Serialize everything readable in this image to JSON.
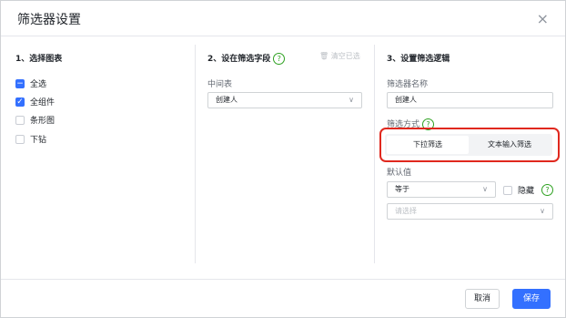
{
  "dialog": {
    "title": "筛选器设置",
    "close_glyph": "×"
  },
  "col1": {
    "title": "1、选择图表",
    "items": [
      {
        "label": "全选",
        "state": "indeterminate",
        "mark": "−"
      },
      {
        "label": "全组件",
        "state": "checked",
        "mark": "✓"
      },
      {
        "label": "条形图",
        "state": "unchecked",
        "mark": ""
      },
      {
        "label": "下钻",
        "state": "unchecked",
        "mark": ""
      }
    ]
  },
  "col2": {
    "title": "2、设在筛选字段",
    "help": "?",
    "clear_label": "🗑 清空已选",
    "table_label": "中间表",
    "field_value": "创建人",
    "chevron": "∨"
  },
  "col3": {
    "title": "3、设置筛选逻辑",
    "name_label": "筛选器名称",
    "name_value": "创建人",
    "mode_label": "筛选方式",
    "help": "?",
    "tabs": [
      {
        "label": "下拉筛选",
        "active": true
      },
      {
        "label": "文本输入筛选",
        "active": false
      }
    ],
    "default_label": "默认值",
    "operator_value": "等于",
    "hide_label": "隐藏",
    "value_placeholder": "请选择",
    "chevron": "∨"
  },
  "footer": {
    "cancel_label": "取消",
    "save_label": "保存"
  },
  "colors": {
    "accent": "#3370ff",
    "highlight": "#e0281e",
    "help": "#2ea121"
  }
}
